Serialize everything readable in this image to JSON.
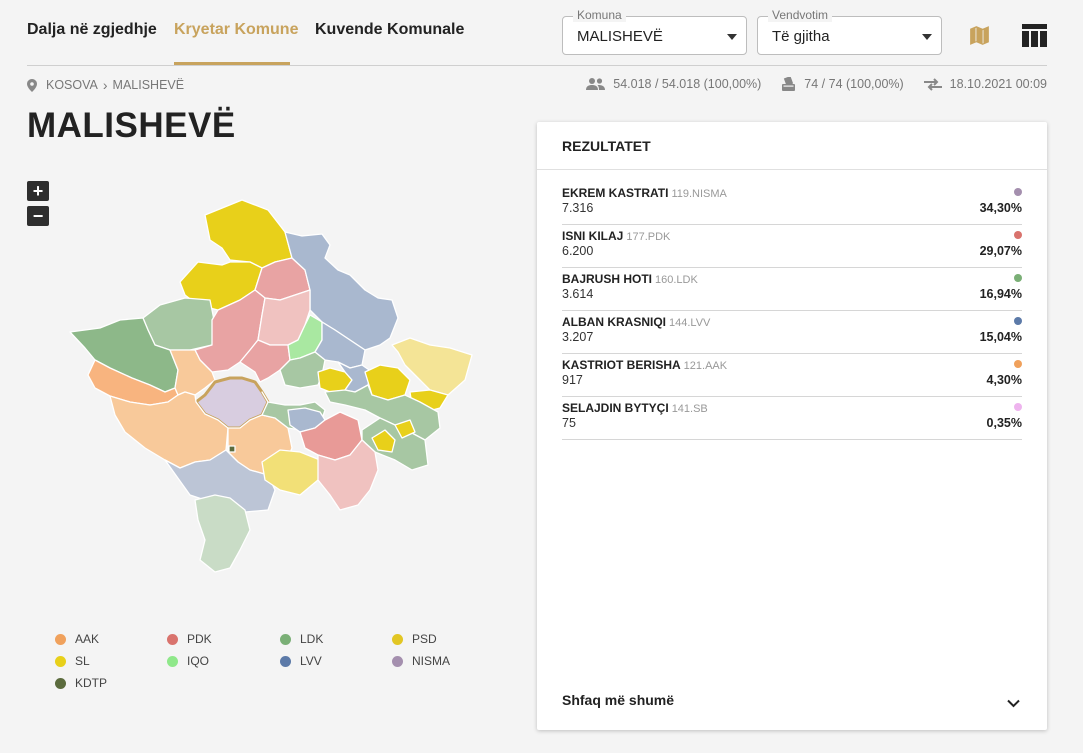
{
  "nav": {
    "tabs": [
      {
        "label": "Dalja në zgjedhje"
      },
      {
        "label": "Kryetar Komune"
      },
      {
        "label": "Kuvende Komunale"
      }
    ],
    "komuna": {
      "label": "Komuna",
      "value": "MALISHEVË"
    },
    "vendvotim": {
      "label": "Vendvotim",
      "value": "Të gjitha"
    },
    "icons": [
      "map-icon",
      "table-icon"
    ]
  },
  "breadcrumb": {
    "root": "KOSOVA",
    "separator": "›",
    "current": "MALISHEVË"
  },
  "stats": {
    "voters": "54.018 / 54.018 (100,00%)",
    "stations": "74 / 74 (100,00%)",
    "updated": "18.10.2021 00:09"
  },
  "title": "MALISHEVË",
  "zoom": {
    "in": "+",
    "out": "−"
  },
  "legend": [
    {
      "label": "AAK",
      "color": "#f0a15c"
    },
    {
      "label": "PDK",
      "color": "#d9736d"
    },
    {
      "label": "LDK",
      "color": "#7aaf76"
    },
    {
      "label": "PSD",
      "color": "#e2c623"
    },
    {
      "label": "SL",
      "color": "#e8d01a"
    },
    {
      "label": "IQO",
      "color": "#8fe88a"
    },
    {
      "label": "LVV",
      "color": "#5c7aa8"
    },
    {
      "label": "NISMA",
      "color": "#a48fae"
    },
    {
      "label": "KDTP",
      "color": "#5b6b3d"
    }
  ],
  "results": {
    "title": "REZULTATET",
    "rows": [
      {
        "name": "EKREM KASTRATI",
        "party": "119.NISMA",
        "votes": "7.316",
        "pct": "34,30%",
        "color": "#a48fae"
      },
      {
        "name": "ISNI KILAJ",
        "party": "177.PDK",
        "votes": "6.200",
        "pct": "29,07%",
        "color": "#d9736d"
      },
      {
        "name": "BAJRUSH HOTI",
        "party": "160.LDK",
        "votes": "3.614",
        "pct": "16,94%",
        "color": "#7aaf76"
      },
      {
        "name": "ALBAN KRASNIQI",
        "party": "144.LVV",
        "votes": "3.207",
        "pct": "15,04%",
        "color": "#5c7aa8"
      },
      {
        "name": "KASTRIOT BERISHA",
        "party": "121.AAK",
        "votes": "917",
        "pct": "4,30%",
        "color": "#f0a15c"
      },
      {
        "name": "SELAJDIN BYTYÇI",
        "party": "141.SB",
        "votes": "75",
        "pct": "0,35%",
        "color": "#eeb4ee"
      }
    ],
    "more": "Shfaq më shumë"
  }
}
